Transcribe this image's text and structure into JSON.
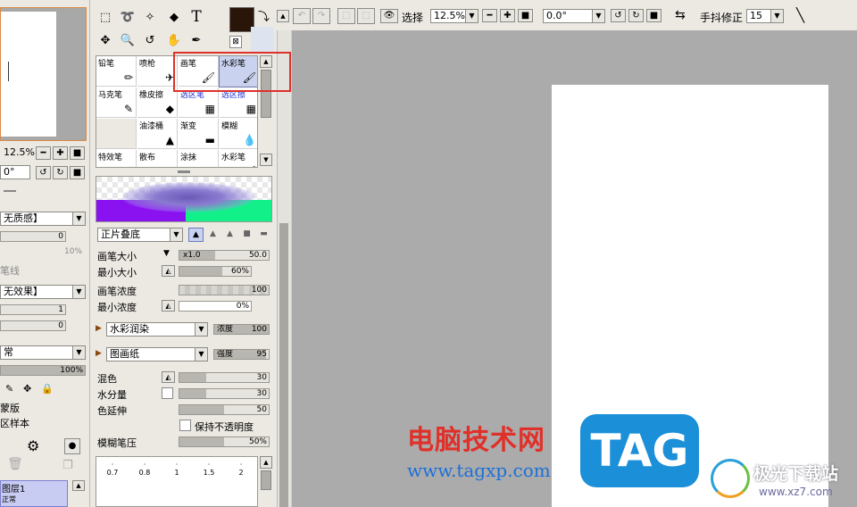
{
  "left_panel": {
    "zoom_value": "12.5%",
    "angle_value": "0°",
    "texture_select": "无质感】",
    "texture_value": "0",
    "texture_pct": "10%",
    "line_label": "笔线",
    "effect_select": "无效果】",
    "effect_v1": "1",
    "effect_v2": "0",
    "blend_mode": "常",
    "opacity": "100%",
    "tools_row_label_1": "蒙版",
    "tools_row_label_2": "区样本",
    "layer_name": "图层1",
    "layer_mode": "正常"
  },
  "tools": {
    "color_swatch": "#2a1608"
  },
  "brushes": [
    {
      "name": "铅笔",
      "icon": "✏"
    },
    {
      "name": "喷枪",
      "icon": "✈"
    },
    {
      "name": "画笔",
      "icon": "🖌"
    },
    {
      "name": "水彩笔",
      "icon": "🖌"
    },
    {
      "name": "马克笔",
      "icon": "✎"
    },
    {
      "name": "橡皮擦",
      "icon": "◆"
    },
    {
      "name": "选区笔",
      "icon": "▦"
    },
    {
      "name": "选区擦",
      "icon": "▦"
    },
    {
      "name": "",
      "icon": ""
    },
    {
      "name": "油漆桶",
      "icon": "▲"
    },
    {
      "name": "渐变",
      "icon": "▬"
    },
    {
      "name": "模糊",
      "icon": "💧"
    },
    {
      "name": "特效笔",
      "icon": "✏"
    },
    {
      "name": "散布",
      "icon": "∴"
    },
    {
      "name": "涂抹",
      "icon": "◢"
    },
    {
      "name": "水彩笔",
      "icon": "🖌"
    }
  ],
  "brush_settings": {
    "blend_mode": "正片叠底",
    "size_label": "画笔大小",
    "size_mult": "x1.0",
    "size_value": "50.0",
    "min_size_label": "最小大小",
    "min_size_value": "60%",
    "min_size_level": 0.6,
    "density_label": "画笔浓度",
    "density_value": "100",
    "min_density_label": "最小浓度",
    "min_density_value": "0%",
    "watercolor_select": "水彩润染",
    "watercolor_label": "浓度",
    "watercolor_value": "100",
    "paper_select": "图画纸",
    "strength_label": "强度",
    "strength_value": "95",
    "mix_label": "混色",
    "mix_value": "30",
    "water_label": "水分量",
    "water_value": "30",
    "extend_label": "色延伸",
    "extend_value": "50",
    "keep_opacity_label": "保持不透明度",
    "blur_label": "模糊笔压",
    "blur_value": "50%",
    "dot_sizes": [
      "0.7",
      "0.8",
      "1",
      "1.5",
      "2"
    ]
  },
  "toolbar": {
    "select_label": "选择",
    "zoom_value": "12.5%",
    "angle_value": "0.0°",
    "stabilizer_label": "手抖修正",
    "stabilizer_value": "15"
  },
  "watermark": {
    "site_name": "电脑技术网",
    "site_url": "www.tagxp.com",
    "tag_text": "TAG",
    "logo_text": "极光下载站",
    "logo_url": "www.xz7.com"
  },
  "colors": {
    "highlight": "#e0302a",
    "canvas_bg": "#ababab",
    "tag_blue": "#1b8fd8"
  }
}
